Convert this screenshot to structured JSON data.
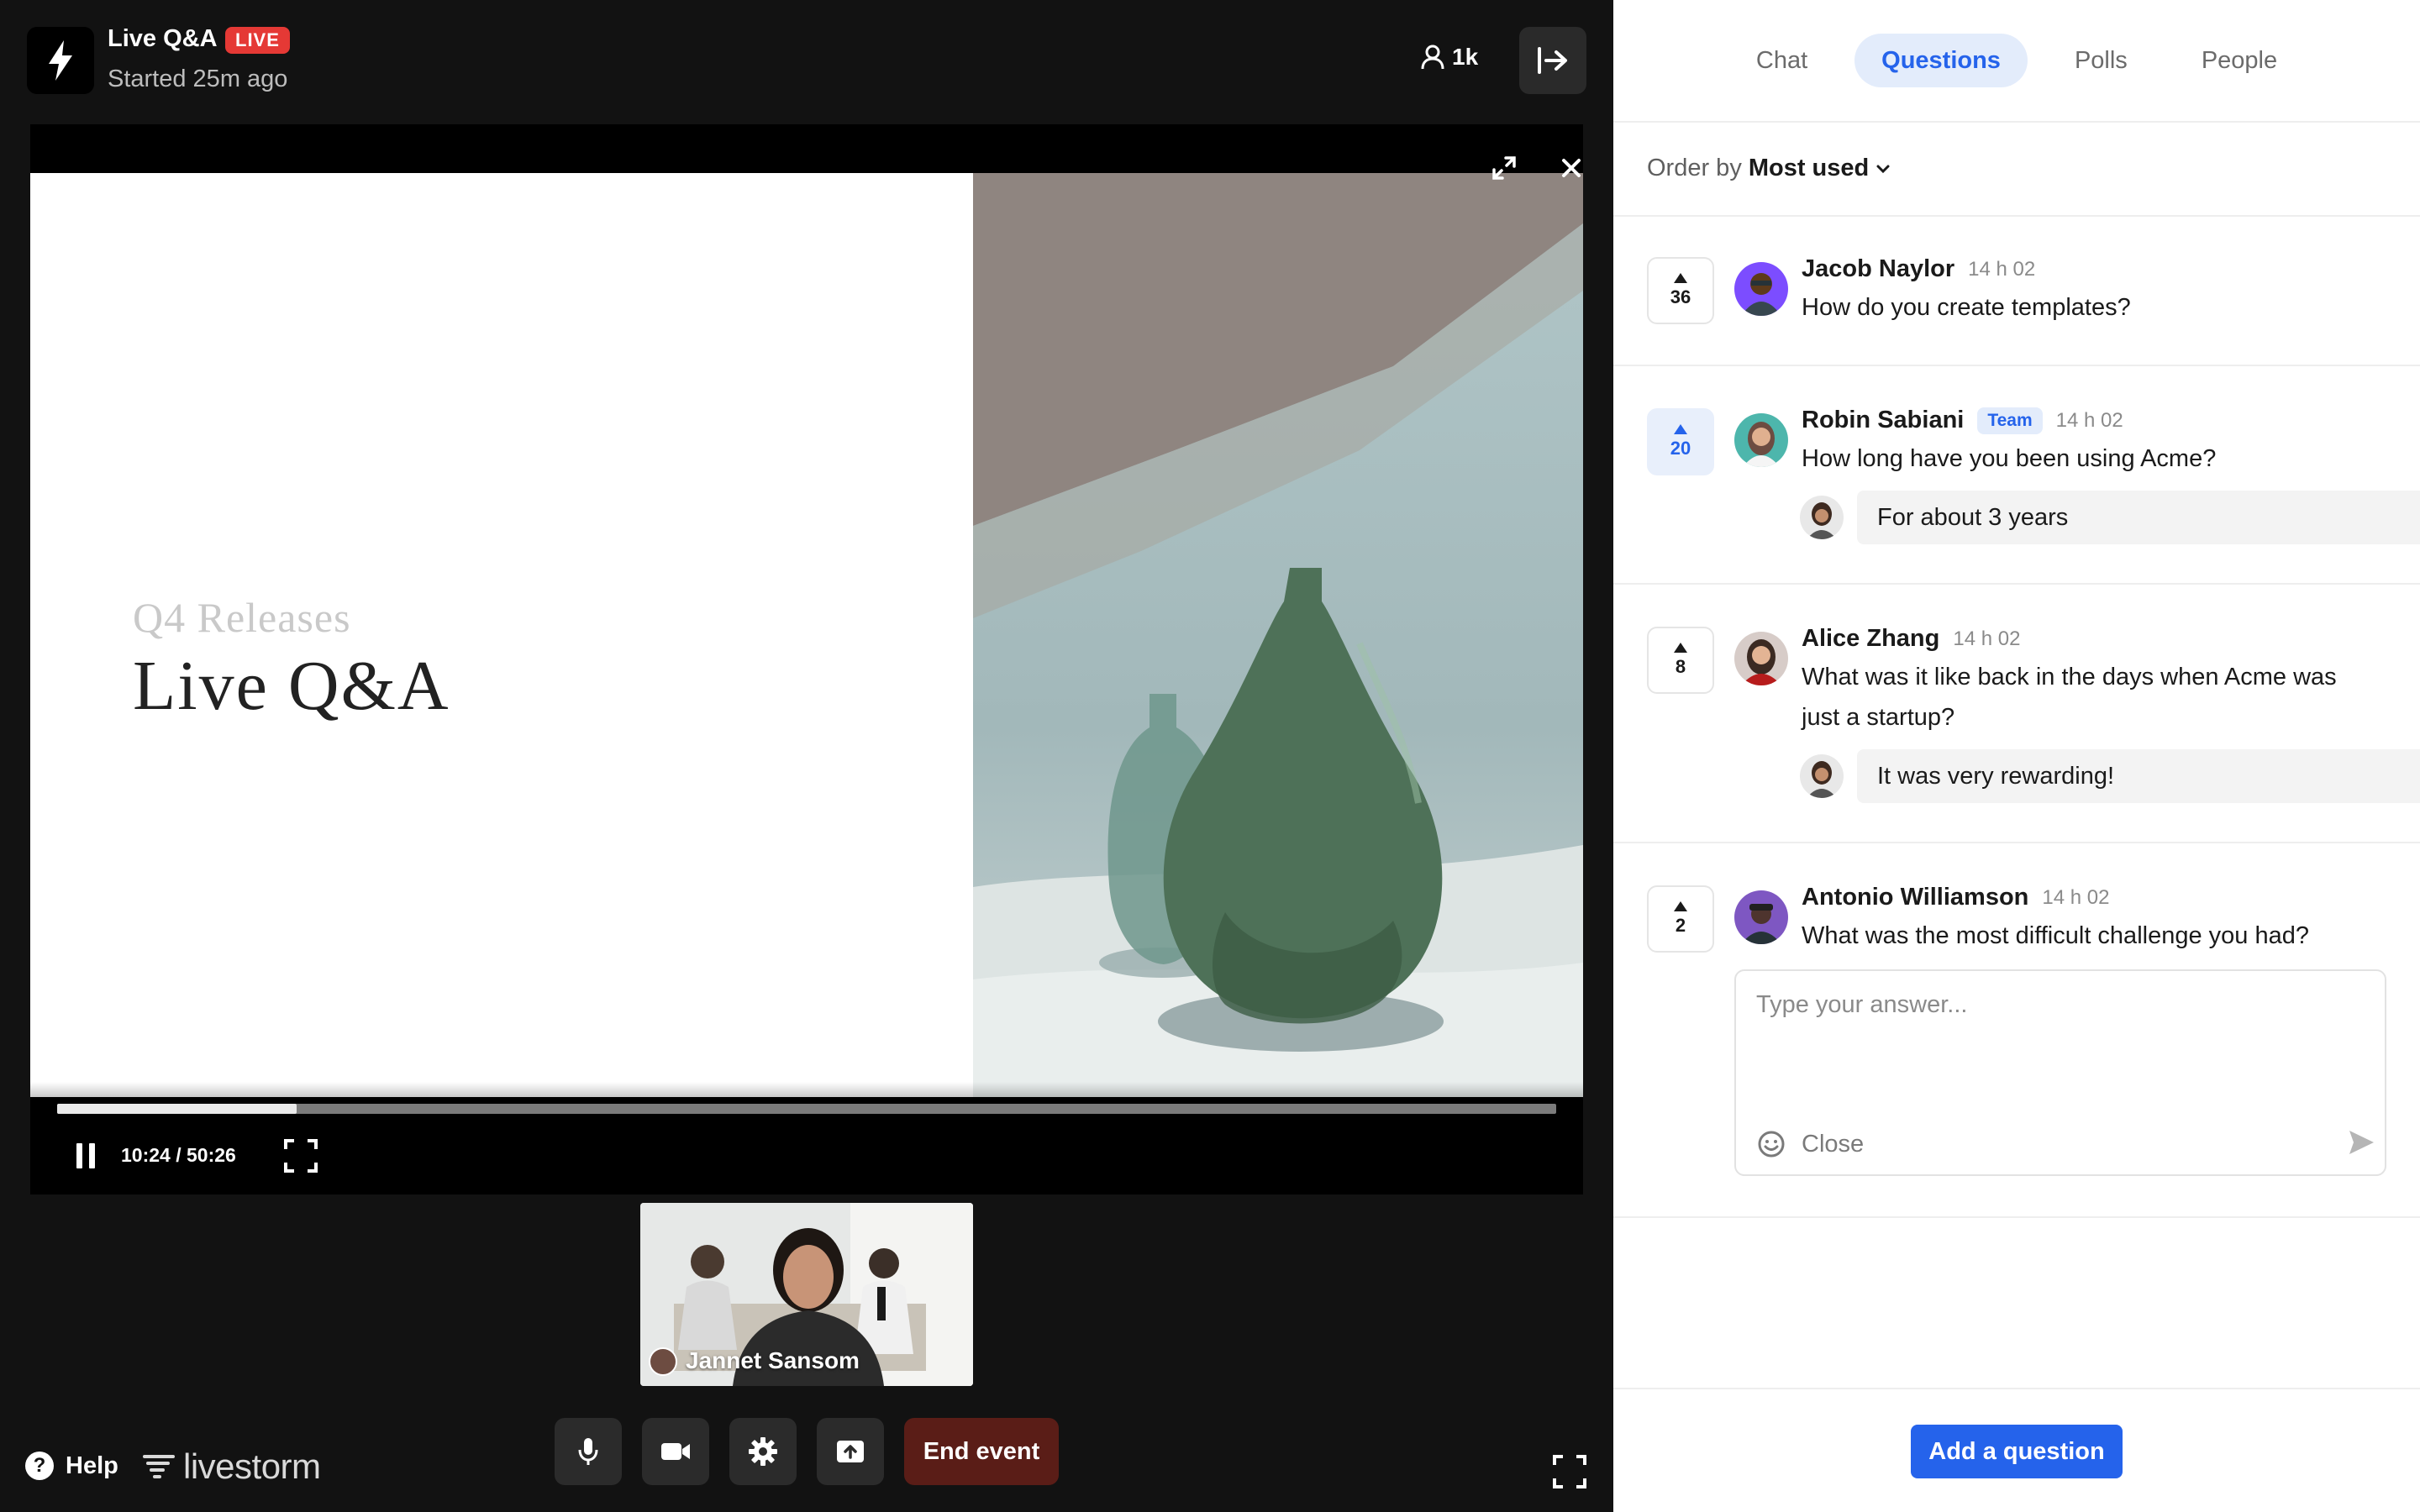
{
  "event": {
    "title": "Live Q&A",
    "live_badge": "LIVE",
    "started": "Started 25m ago",
    "viewers": "1k",
    "icons": {
      "app": "bolt-icon",
      "viewers": "person-icon",
      "exit": "exit-icon"
    }
  },
  "video": {
    "slide_subtitle": "Q4  Releases",
    "slide_title": "Live  Q&A",
    "current_time": "10:24",
    "separator": " / ",
    "duration": "50:26",
    "progress": 0.16
  },
  "speaker": {
    "name": "Jannet Sansom"
  },
  "footer": {
    "help_label": "Help",
    "help_glyph": "?",
    "brand": "livestorm",
    "end_event_label": "End event",
    "controls": [
      "microphone-icon",
      "camera-icon",
      "settings-icon",
      "share-screen-icon"
    ]
  },
  "panel": {
    "tabs": [
      {
        "label": "Chat",
        "active": false
      },
      {
        "label": "Questions",
        "active": true
      },
      {
        "label": "Polls",
        "active": false
      },
      {
        "label": "People",
        "active": false
      }
    ],
    "order_prefix": "Order by",
    "order_value": "Most used",
    "questions": [
      {
        "votes": "36",
        "upvoted": false,
        "author": "Jacob Naylor",
        "badge": "",
        "time": "14 h 02",
        "text": "How do you create templates?",
        "answer": ""
      },
      {
        "votes": "20",
        "upvoted": true,
        "author": "Robin Sabiani",
        "badge": "Team",
        "time": "14 h 02",
        "text": "How long have you been using Acme?",
        "answer": "For about 3 years"
      },
      {
        "votes": "8",
        "upvoted": false,
        "author": "Alice Zhang",
        "badge": "",
        "time": "14 h 02",
        "text": "What was it like back in the days when Acme was just a startup?",
        "answer": "It was very rewarding!"
      },
      {
        "votes": "2",
        "upvoted": false,
        "author": "Antonio Williamson",
        "badge": "",
        "time": "14 h 02",
        "text": "What was the most difficult challenge you had?",
        "answer": ""
      }
    ],
    "reply": {
      "placeholder": "Type your answer...",
      "close_label": "Close"
    },
    "add_question_label": "Add a question"
  },
  "colors": {
    "accent": "#2563eb",
    "live": "#e53935",
    "end_event": "#5a1d17",
    "stage_bg": "#121212"
  }
}
